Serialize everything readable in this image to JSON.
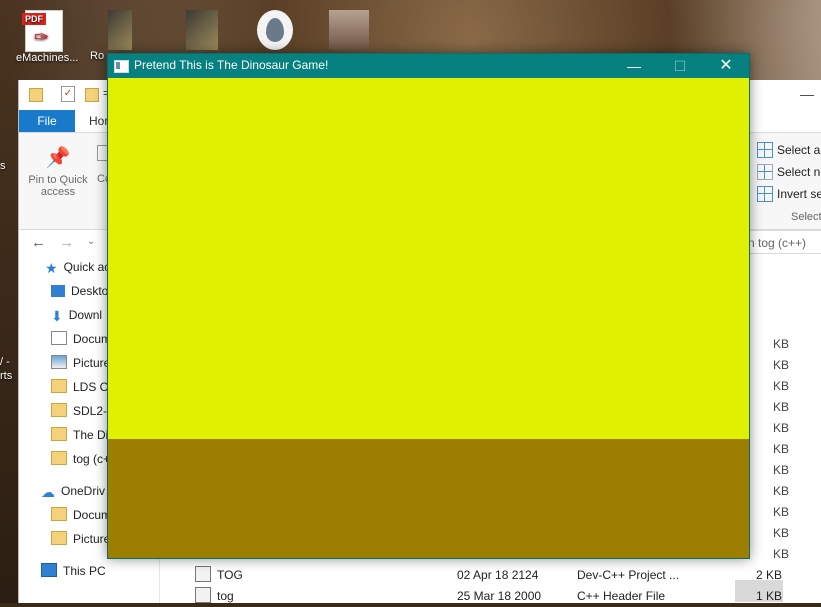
{
  "desktop": {
    "icons": [
      {
        "label": "eMachines...",
        "kind": "pdf"
      },
      {
        "label": "Ro",
        "kind": "dark"
      },
      {
        "label": "",
        "kind": "dark"
      },
      {
        "label": "",
        "kind": "drop"
      },
      {
        "label": "",
        "kind": "photo"
      }
    ],
    "side_fragments": [
      "s",
      "/ -",
      "rts"
    ]
  },
  "explorer": {
    "quick_access_toolbar": {
      "dropdown_glyph": "=",
      "close": "—"
    },
    "tabs": {
      "file": "File",
      "home": "Hor"
    },
    "ribbon": {
      "pin_label": "Pin to Quick access",
      "copy_fragment": "Co",
      "select_all": "Select all",
      "select_none": "Select no",
      "invert_selection": "Invert sel",
      "select_group": "Select"
    },
    "search_placeholder": "n tog (c++)",
    "nav": [
      {
        "label": "Quick ac",
        "icon": "star-icon"
      },
      {
        "label": "Deskto",
        "icon": "desktop-icon"
      },
      {
        "label": "Downl",
        "icon": "download-icon"
      },
      {
        "label": "Docum",
        "icon": "documents-icon"
      },
      {
        "label": "Picture",
        "icon": "pictures-icon"
      },
      {
        "label": "LDS CH",
        "icon": "folder-icon"
      },
      {
        "label": "SDL2-2",
        "icon": "folder-icon"
      },
      {
        "label": "The Din",
        "icon": "folder-icon"
      },
      {
        "label": "tog (c+",
        "icon": "folder-icon"
      },
      {
        "label": "OneDriv",
        "icon": "onedrive-icon"
      },
      {
        "label": "Docum",
        "icon": "folder-icon"
      },
      {
        "label": "Pictures",
        "icon": "folder-icon"
      },
      {
        "label": "This PC",
        "icon": "pc-icon"
      }
    ],
    "sizes": [
      "KB",
      "KB",
      "KB",
      "KB",
      "KB",
      "KB",
      "KB",
      "KB",
      "KB",
      "KB",
      "KB"
    ],
    "files": [
      {
        "name": "TOG",
        "date": "02 Apr 18 2124",
        "type": "Dev-C++ Project ...",
        "size": "2 KB"
      },
      {
        "name": "tog",
        "date": "25 Mar 18 2000",
        "type": "C++ Header File",
        "size": "1 KB"
      }
    ]
  },
  "game_window": {
    "title": "Pretend This is The Dinosaur Game!",
    "buttons": {
      "minimize": "—",
      "maximize": "☐",
      "close": "✕"
    },
    "colors": {
      "titlebar": "#078080",
      "sky": "#e0f000",
      "ground": "#9e7e00"
    }
  }
}
